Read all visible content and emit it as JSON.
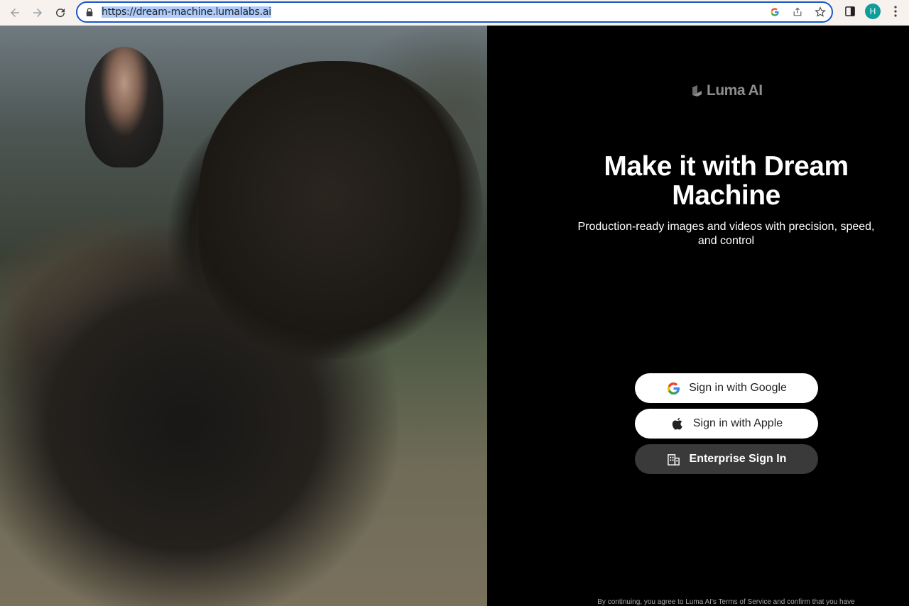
{
  "browser": {
    "url": "https://dream-machine.lumalabs.ai",
    "profile_initial": "H"
  },
  "brand": {
    "logo_text": "Luma AI"
  },
  "hero": {
    "headline": "Make it with Dream Machine",
    "subheadline": "Production-ready images and videos with precision, speed, and control"
  },
  "signin": {
    "google_label": "Sign in with Google",
    "apple_label": "Sign in with Apple",
    "enterprise_label": "Enterprise Sign In"
  },
  "legal": {
    "text": "By continuing, you agree to Luma AI's Terms of Service and confirm that you have"
  },
  "colors": {
    "accent_blue": "#1a57c8",
    "avatar_teal": "#0f9d9a",
    "panel_bg": "#000000",
    "enterprise_btn": "#3a3a3a"
  }
}
